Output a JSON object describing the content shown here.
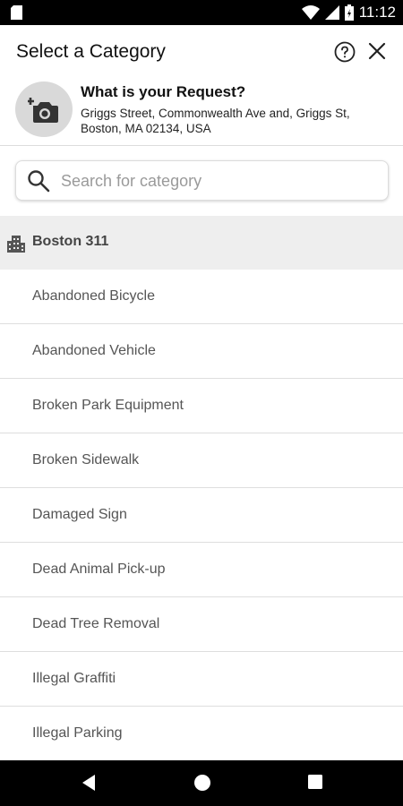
{
  "status_bar": {
    "time": "11:12"
  },
  "header": {
    "title": "Select a Category"
  },
  "request": {
    "heading": "What is your Request?",
    "address": "Griggs Street, Commonwealth Ave and, Griggs St, Boston, MA 02134, USA"
  },
  "search": {
    "placeholder": "Search for category"
  },
  "group": {
    "label": "Boston 311"
  },
  "categories": [
    "Abandoned Bicycle",
    "Abandoned Vehicle",
    "Broken Park Equipment",
    "Broken Sidewalk",
    "Damaged Sign",
    "Dead Animal Pick-up",
    "Dead Tree Removal",
    "Illegal Graffiti",
    "Illegal Parking"
  ],
  "icons": {
    "help": "help-circle-icon",
    "close": "close-icon",
    "camera": "add-photo-icon",
    "search": "search-icon",
    "group": "building-icon"
  }
}
